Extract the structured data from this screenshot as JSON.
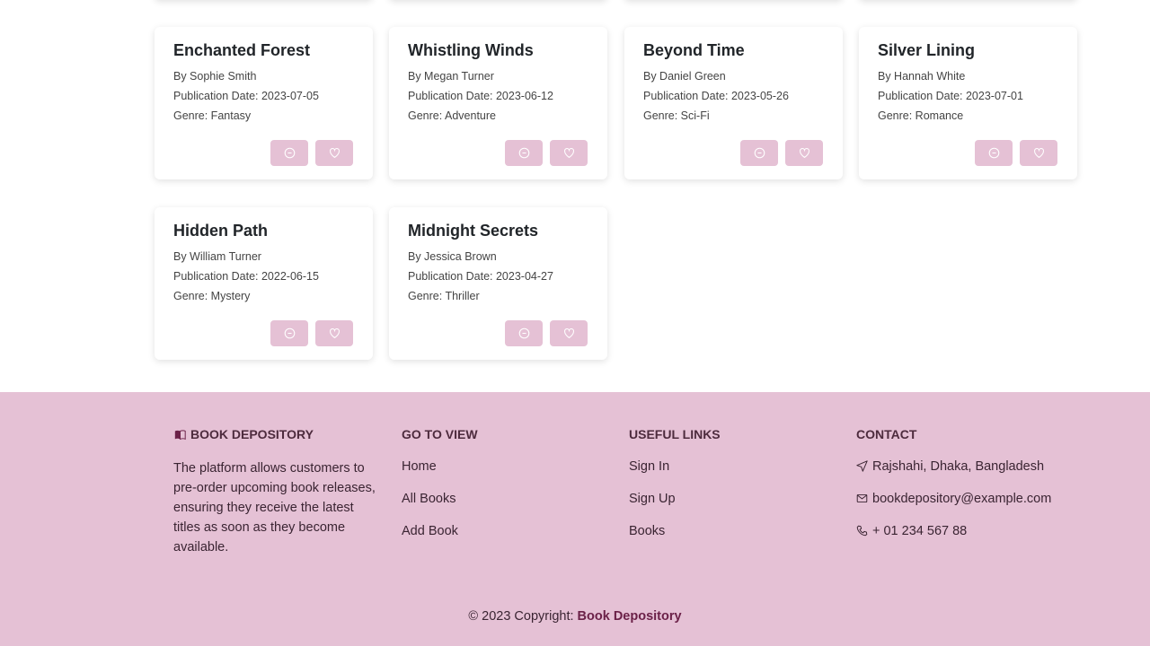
{
  "books": [
    {
      "title": "Enchanted Forest",
      "author": "By Sophie Smith",
      "date": "Publication Date: 2023-07-05",
      "genre": "Genre: Fantasy"
    },
    {
      "title": "Whistling Winds",
      "author": "By Megan Turner",
      "date": "Publication Date: 2023-06-12",
      "genre": "Genre: Adventure"
    },
    {
      "title": "Beyond Time",
      "author": "By Daniel Green",
      "date": "Publication Date: 2023-05-26",
      "genre": "Genre: Sci-Fi"
    },
    {
      "title": "Silver Lining",
      "author": "By Hannah White",
      "date": "Publication Date: 2023-07-01",
      "genre": "Genre: Romance"
    },
    {
      "title": "Hidden Path",
      "author": "By William Turner",
      "date": "Publication Date: 2022-06-15",
      "genre": "Genre: Mystery"
    },
    {
      "title": "Midnight Secrets",
      "author": "By Jessica Brown",
      "date": "Publication Date: 2023-04-27",
      "genre": "Genre: Thriller"
    }
  ],
  "footer": {
    "brand": {
      "title": "BOOK DEPOSITORY",
      "icon": "book-icon",
      "description": "The platform allows customers to pre-order upcoming book releases, ensuring they receive the latest titles as soon as they become available."
    },
    "go_to_view": {
      "title": "GO TO VIEW",
      "links": [
        "Home",
        "All Books",
        "Add Book"
      ]
    },
    "useful_links": {
      "title": "USEFUL LINKS",
      "links": [
        "Sign In",
        "Sign Up",
        "Books"
      ]
    },
    "contact": {
      "title": "CONTACT",
      "address": "Rajshahi, Dhaka, Bangladesh",
      "email": "bookdepository@example.com",
      "phone": "+ 01 234 567 88"
    },
    "copyright_prefix": "© 2023 Copyright: ",
    "copyright_brand": "Book Depository"
  },
  "colors": {
    "accent": "#e5c1d5",
    "brand": "#6b2148"
  }
}
